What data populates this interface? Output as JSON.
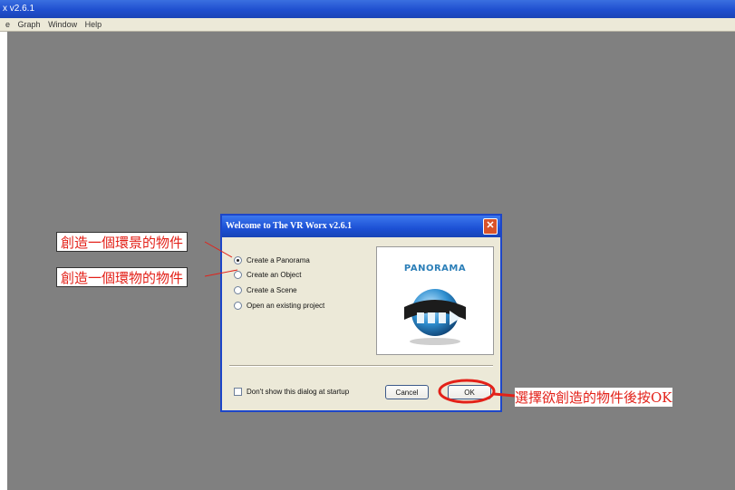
{
  "app": {
    "title": "x v2.6.1",
    "menu": [
      "e",
      "Graph",
      "Window",
      "Help"
    ]
  },
  "dialog": {
    "title": "Welcome to The VR Worx v2.6.1",
    "close_glyph": "✕",
    "options": [
      {
        "label": "Create a Panorama",
        "checked": true
      },
      {
        "label": "Create an Object",
        "checked": false
      },
      {
        "label": "Create a Scene",
        "checked": false
      },
      {
        "label": "Open an existing project",
        "checked": false
      }
    ],
    "preview_label": "PANORAMA",
    "checkbox_label": "Don't show this dialog at startup",
    "cancel_label": "Cancel",
    "ok_label": "OK"
  },
  "annotations": {
    "panorama_note": "創造一個環景的物件",
    "object_note": "創造一個環物的物件",
    "ok_note": "選擇欲創造的物件後按OK"
  },
  "colors": {
    "annotation_red": "#e32119",
    "xp_blue": "#1f4fcf",
    "workspace_gray": "#808080"
  }
}
